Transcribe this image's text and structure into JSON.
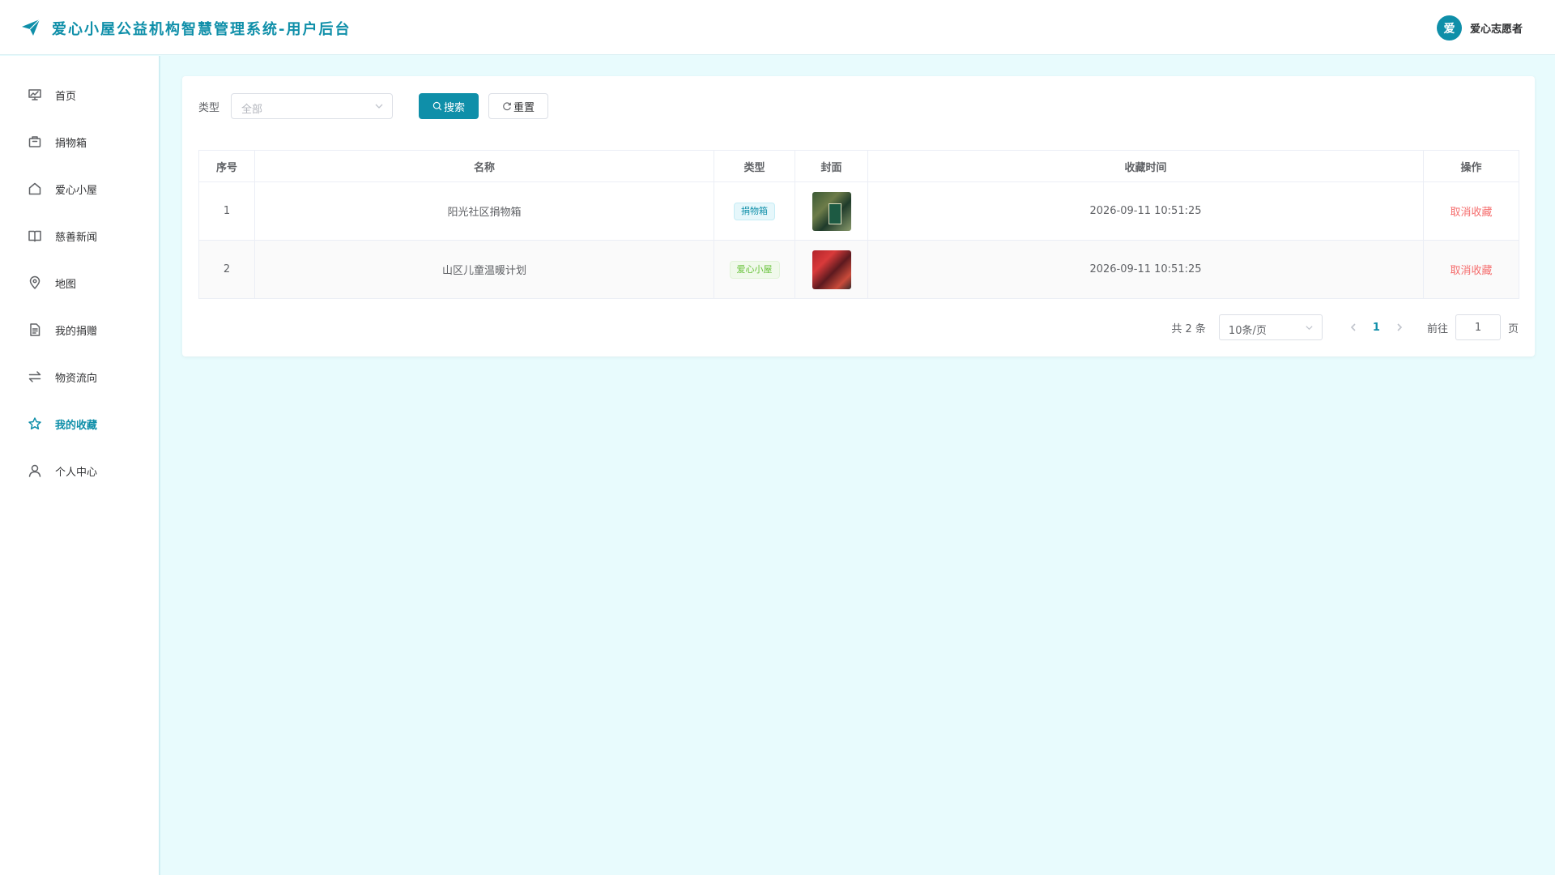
{
  "header": {
    "title": "爱心小屋公益机构智慧管理系统-用户后台",
    "avatar_text": "爱",
    "username": "爱心志愿者"
  },
  "sidebar": {
    "items": [
      {
        "label": "首页",
        "icon": "chart-board-icon"
      },
      {
        "label": "捐物箱",
        "icon": "box-icon"
      },
      {
        "label": "爱心小屋",
        "icon": "home-icon"
      },
      {
        "label": "慈善新闻",
        "icon": "book-icon"
      },
      {
        "label": "地图",
        "icon": "location-icon"
      },
      {
        "label": "我的捐赠",
        "icon": "document-icon"
      },
      {
        "label": "物资流向",
        "icon": "transfer-icon"
      },
      {
        "label": "我的收藏",
        "icon": "star-icon",
        "active": true
      },
      {
        "label": "个人中心",
        "icon": "user-icon"
      }
    ]
  },
  "filter": {
    "type_label": "类型",
    "type_placeholder": "全部",
    "search_label": "搜索",
    "reset_label": "重置"
  },
  "table": {
    "columns": [
      "序号",
      "名称",
      "类型",
      "封面",
      "收藏时间",
      "操作"
    ],
    "rows": [
      {
        "index": "1",
        "name": "阳光社区捐物箱",
        "type": "捐物箱",
        "collect_time": "2026-09-11 10:51:25",
        "action": "取消收藏"
      },
      {
        "index": "2",
        "name": "山区儿童温暖计划",
        "type": "爱心小屋",
        "collect_time": "2026-09-11 10:51:25",
        "action": "取消收藏"
      }
    ]
  },
  "pagination": {
    "total_text": "共 2 条",
    "page_size": "10条/页",
    "current_page": "1",
    "goto_label": "前往",
    "goto_value": "1",
    "page_suffix": "页"
  },
  "colors": {
    "primary": "#0f8fa9",
    "background": "#e8fbfd",
    "danger": "#f56c6c",
    "success": "#67c23a"
  }
}
